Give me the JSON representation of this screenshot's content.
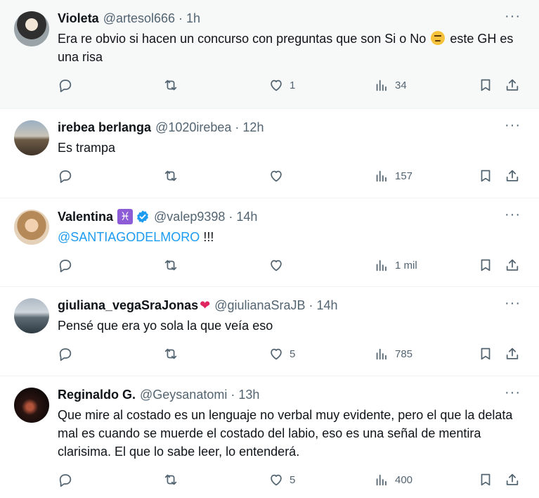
{
  "tweets": [
    {
      "name": "Violeta",
      "handle": "@artesol666",
      "dot": "·",
      "time": "1h",
      "text_before": "Era re obvio si hacen un concurso con preguntas que son Si o No",
      "text_after": " este GH es una risa",
      "emoji": "face-with-rolling-eyes",
      "likes": "1",
      "views": "34"
    },
    {
      "name": "irebea berlanga",
      "handle": "@1020irebea",
      "dot": "·",
      "time": "12h",
      "text": "Es trampa",
      "likes": "",
      "views": "157"
    },
    {
      "name": "Valentina",
      "zodiac": "♓",
      "handle": "@valep9398",
      "dot": "·",
      "time": "14h",
      "mention": "@SANTIAGODELMORO",
      "text_after": " !!!",
      "likes": "",
      "views": "1 mil"
    },
    {
      "name": "giuliana_vegaSraJonas",
      "name_emoji": "❤",
      "handle": "@giulianaSraJB",
      "dot": "·",
      "time": "14h",
      "text": "Pensé que era yo sola la que veía eso",
      "likes": "5",
      "views": "785"
    },
    {
      "name": "Reginaldo G.",
      "handle": "@Geysanatomi",
      "dot": "·",
      "time": "13h",
      "text": "Que mire al costado es un lenguaje no verbal muy evidente, pero el que la delata mal es cuando se muerde el costado del labio, eso es una señal de mentira clarisima. El que lo sabe leer, lo entenderá.",
      "likes": "5",
      "views": "400"
    }
  ],
  "more_glyph": "···",
  "colors": {
    "link": "#1d9bf0",
    "muted": "#536471",
    "verified": "#1d9bf0",
    "highlight_bg": "#f7f9f9"
  },
  "icons": [
    "reply-icon",
    "retweet-icon",
    "like-icon",
    "views-icon",
    "bookmark-icon",
    "share-icon",
    "more-icon",
    "verified-badge-icon"
  ]
}
